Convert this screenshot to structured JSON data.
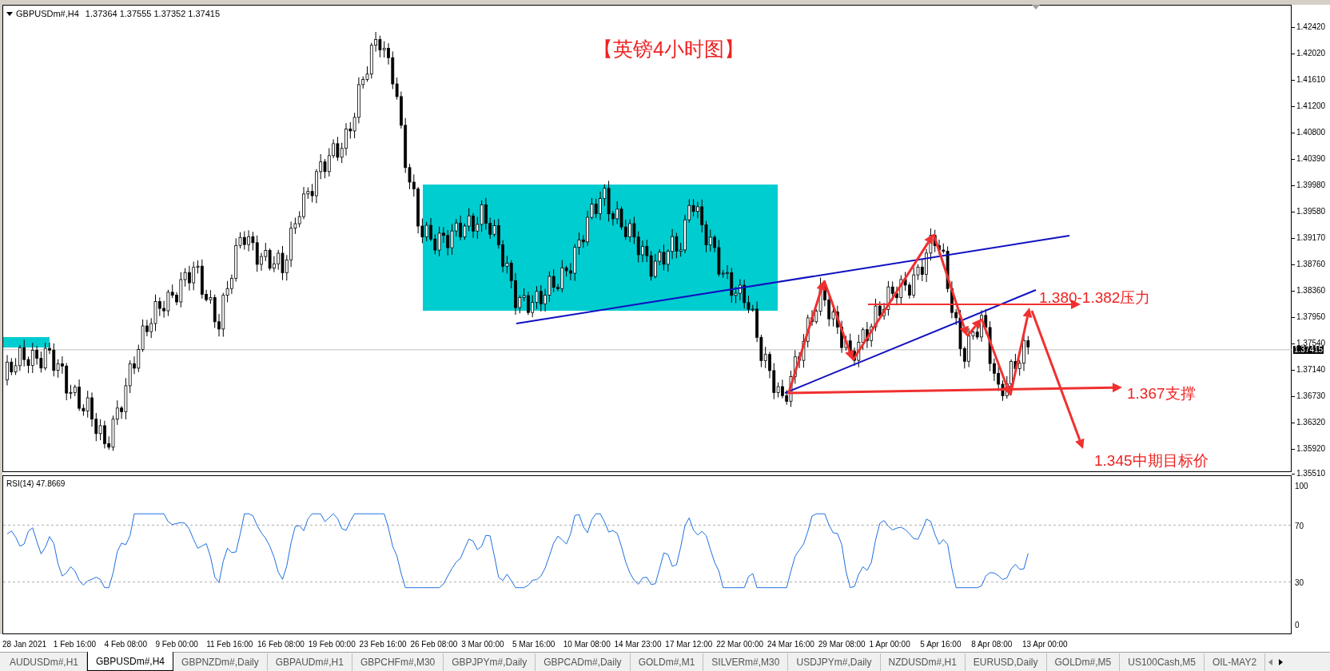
{
  "chart": {
    "symbol": "GBPUSDm#,H4",
    "ohlc": "1.37364 1.37555 1.37352 1.37415",
    "title": "【英镑4小时图】",
    "annotations": [
      "1.380-1.382压力",
      "1.367支撑",
      "1.345中期目标价"
    ],
    "price_axis": [
      "1.42420",
      "1.42020",
      "1.41610",
      "1.41200",
      "1.40800",
      "1.40390",
      "1.39980",
      "1.39580",
      "1.39170",
      "1.38760",
      "1.38360",
      "1.37950",
      "1.37540",
      "1.37140",
      "1.36730",
      "1.36320",
      "1.35920",
      "1.35510"
    ],
    "current_price": "1.37415"
  },
  "indicator": {
    "label": "RSI(14) 47.8669",
    "axis": [
      "100",
      "70",
      "30",
      "0"
    ]
  },
  "time_axis": [
    "28 Jan 2021",
    "1 Feb 16:00",
    "4 Feb 08:00",
    "9 Feb 00:00",
    "11 Feb 16:00",
    "16 Feb 08:00",
    "19 Feb 00:00",
    "23 Feb 16:00",
    "26 Feb 08:00",
    "3 Mar 00:00",
    "5 Mar 16:00",
    "10 Mar 08:00",
    "14 Mar 23:00",
    "17 Mar 12:00",
    "22 Mar 00:00",
    "24 Mar 16:00",
    "29 Mar 08:00",
    "1 Apr 00:00",
    "5 Apr 16:00",
    "8 Apr 08:00",
    "13 Apr 00:00"
  ],
  "tabs": [
    {
      "label": "AUDUSDm#,H1",
      "selected": false
    },
    {
      "label": "GBPUSDm#,H4",
      "selected": true
    },
    {
      "label": "GBPNZDm#,Daily",
      "selected": false
    },
    {
      "label": "GBPAUDm#,H1",
      "selected": false
    },
    {
      "label": "GBPCHFm#,M30",
      "selected": false
    },
    {
      "label": "GBPJPYm#,Daily",
      "selected": false
    },
    {
      "label": "GBPCADm#,Daily",
      "selected": false
    },
    {
      "label": "GOLDm#,M1",
      "selected": false
    },
    {
      "label": "SILVERm#,M30",
      "selected": false
    },
    {
      "label": "USDJPYm#,Daily",
      "selected": false
    },
    {
      "label": "NZDUSDm#,H1",
      "selected": false
    },
    {
      "label": "EURUSD,Daily",
      "selected": false
    },
    {
      "label": "GOLDm#,M5",
      "selected": false
    },
    {
      "label": "US100Cash,M5",
      "selected": false
    },
    {
      "label": "OIL-MAY2",
      "selected": false
    }
  ]
}
